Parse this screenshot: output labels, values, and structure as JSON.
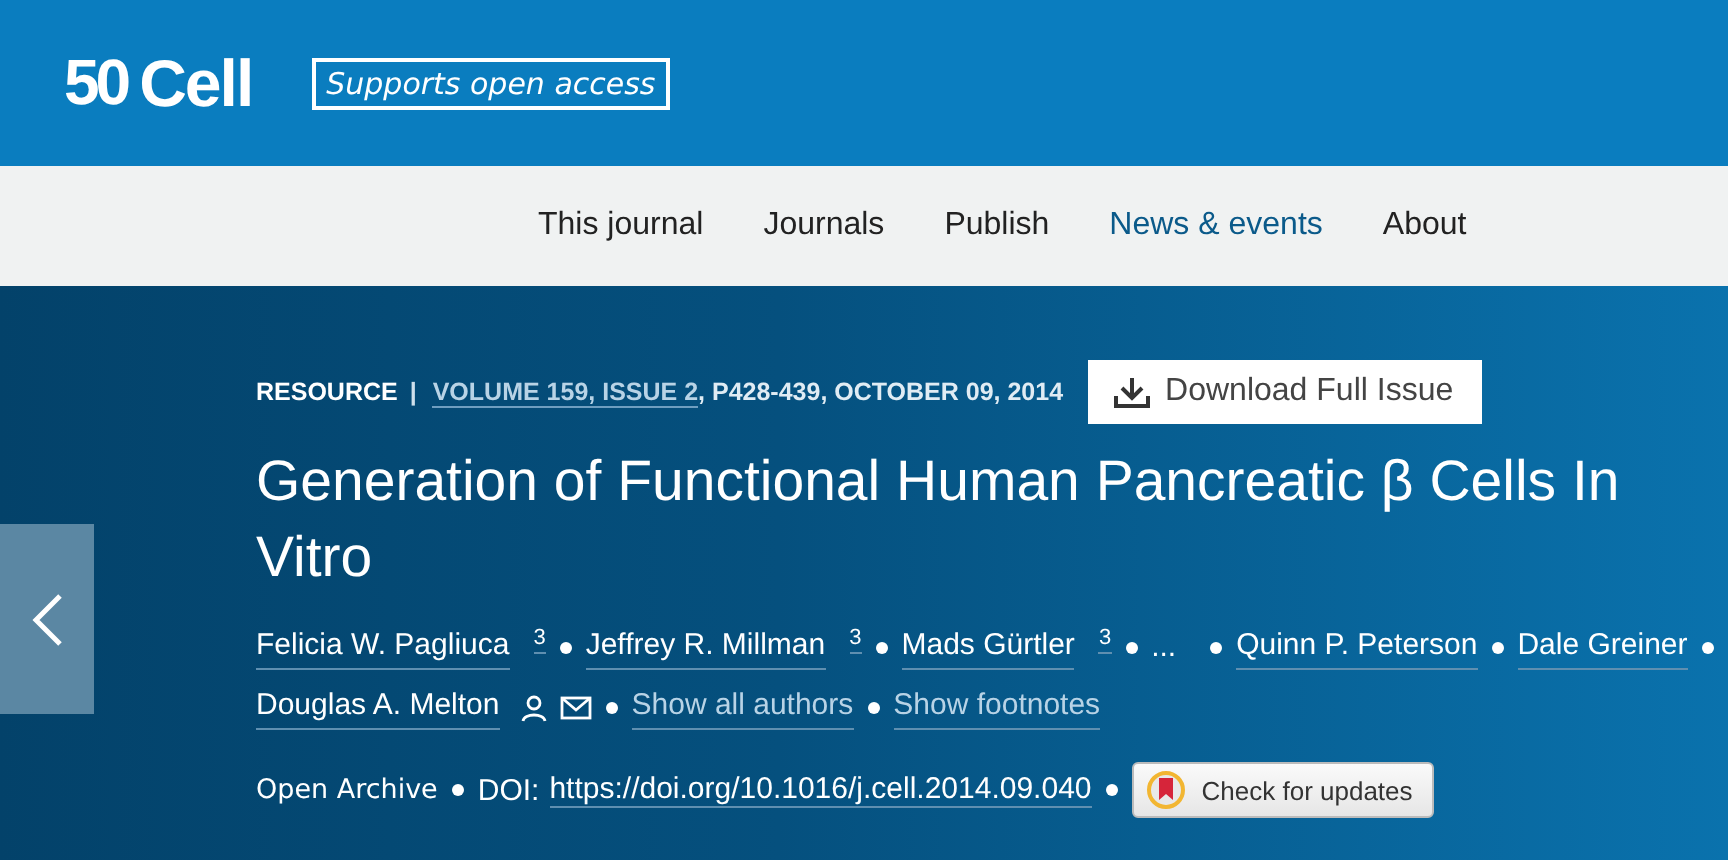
{
  "header": {
    "logo_number": "50",
    "logo_text": "Cell",
    "badge": "Supports open access"
  },
  "nav": [
    {
      "label": "This journal",
      "selected": false
    },
    {
      "label": "Journals",
      "selected": false
    },
    {
      "label": "Publish",
      "selected": false
    },
    {
      "label": "News & events",
      "selected": true
    },
    {
      "label": "About",
      "selected": false
    }
  ],
  "article": {
    "type": "RESOURCE",
    "separator": "|",
    "issue_link": "VOLUME 159, ISSUE 2",
    "issue_rest": ", P428-439, OCTOBER 09, 2014",
    "download_button": "Download Full Issue",
    "title": "Generation of Functional Human Pancreatic β Cells In Vitro",
    "authors": [
      {
        "kind": "author",
        "name": "Felicia W. Pagliuca",
        "note": "3"
      },
      {
        "kind": "author",
        "name": "Jeffrey R. Millman",
        "note": "3"
      },
      {
        "kind": "author",
        "name": "Mads Gürtler",
        "note": "3"
      },
      {
        "kind": "ellipsis",
        "name": "..."
      },
      {
        "kind": "author",
        "name": "Quinn P. Peterson"
      },
      {
        "kind": "author",
        "name": "Dale Greiner"
      },
      {
        "kind": "corresponding",
        "name": "Douglas A. Melton"
      }
    ],
    "author_links": [
      "Show all authors",
      "Show footnotes"
    ],
    "access": "Open Archive",
    "doi_label": "DOI:",
    "doi": "https://doi.org/10.1016/j.cell.2014.09.040",
    "updates_button": "Check for updates"
  }
}
